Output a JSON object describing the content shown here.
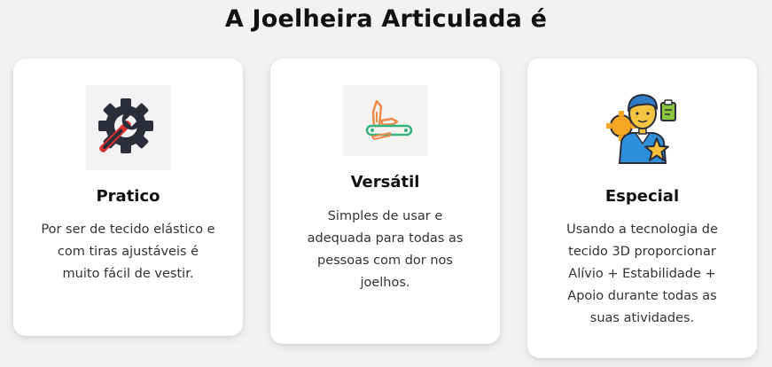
{
  "page": {
    "title": "A Joelheira Articulada é"
  },
  "cards": [
    {
      "icon": "gear-wrench-icon",
      "title": "Pratico",
      "lines": [
        "Por ser de tecido elástico e",
        "com tiras ajustáveis é",
        "muito fácil de vestir."
      ]
    },
    {
      "icon": "pocket-knife-icon",
      "title": "Versátil",
      "lines": [
        "Simples de usar e",
        "adequada para todas as",
        "pessoas com dor nos",
        "joelhos."
      ]
    },
    {
      "icon": "specialist-person-icon",
      "title": "Especial",
      "lines": [
        "Usando a tecnologia de",
        "tecido 3D proporcionar",
        "Alívio + Estabilidade +",
        "Apoio durante todas as",
        "suas atividades."
      ]
    }
  ],
  "colors": {
    "background": "#f2f2f2",
    "card": "#ffffff",
    "gear_dark": "#2b2d3a",
    "wrench_red": "#d9312f",
    "knife_orange": "#f08a4b",
    "knife_green": "#35b37e",
    "person_blue": "#2f8fd8",
    "person_skin": "#f4c542",
    "star_yellow": "#f5c13b"
  }
}
